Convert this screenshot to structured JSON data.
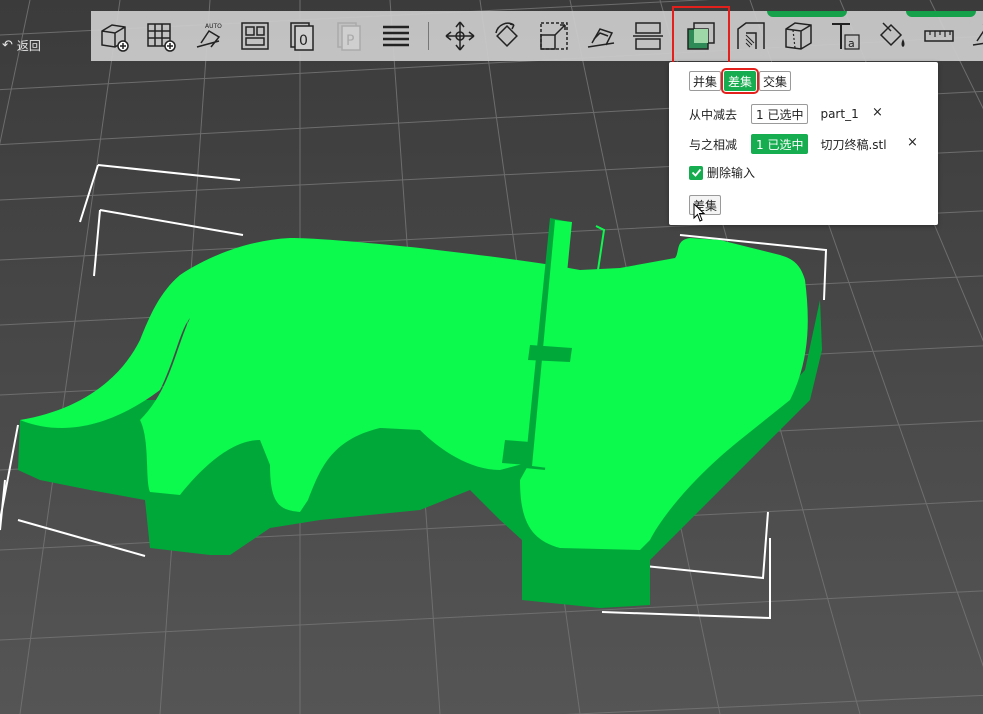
{
  "toolbar": {
    "buttons": [
      {
        "name": "add-object-icon",
        "label": ""
      },
      {
        "name": "add-plate-icon",
        "label": ""
      },
      {
        "name": "auto-orient-icon",
        "label": "AUTO"
      },
      {
        "name": "arrange-icon",
        "label": ""
      },
      {
        "name": "split-to-objects-icon",
        "label": "0"
      },
      {
        "name": "split-to-parts-icon",
        "label": "P"
      },
      {
        "name": "layers-icon",
        "label": ""
      },
      {
        "name": "move-icon",
        "label": ""
      },
      {
        "name": "rotate-icon",
        "label": ""
      },
      {
        "name": "scale-icon",
        "label": ""
      },
      {
        "name": "lay-on-face-icon",
        "label": ""
      },
      {
        "name": "cut-icon",
        "label": ""
      },
      {
        "name": "boolean-icon",
        "label": "",
        "active": true
      },
      {
        "name": "support-paint-icon",
        "label": ""
      },
      {
        "name": "seam-paint-icon",
        "label": ""
      },
      {
        "name": "text-emboss-icon",
        "label": "a"
      },
      {
        "name": "color-paint-icon",
        "label": ""
      },
      {
        "name": "measure-icon",
        "label": ""
      },
      {
        "name": "assembly-icon",
        "label": ""
      }
    ]
  },
  "back_button": {
    "label": "返回"
  },
  "boolean_panel": {
    "tabs": [
      {
        "label": "并集",
        "active": false
      },
      {
        "label": "差集",
        "active": true
      },
      {
        "label": "交集",
        "active": false
      }
    ],
    "subtract_from": {
      "label": "从中减去",
      "button": "1 已选中",
      "object": "part_1"
    },
    "subtract_with": {
      "label": "与之相减",
      "button": "1 已选中",
      "object": "切刀终稿.stl"
    },
    "delete_input": {
      "label": "删除输入",
      "checked": true
    },
    "apply_button": "差集"
  },
  "colors": {
    "accent": "#15ad4f",
    "highlight": "#e3201b",
    "model_top": "#0cf94e",
    "model_side": "#00a83a",
    "background": "#4a4a4a"
  }
}
